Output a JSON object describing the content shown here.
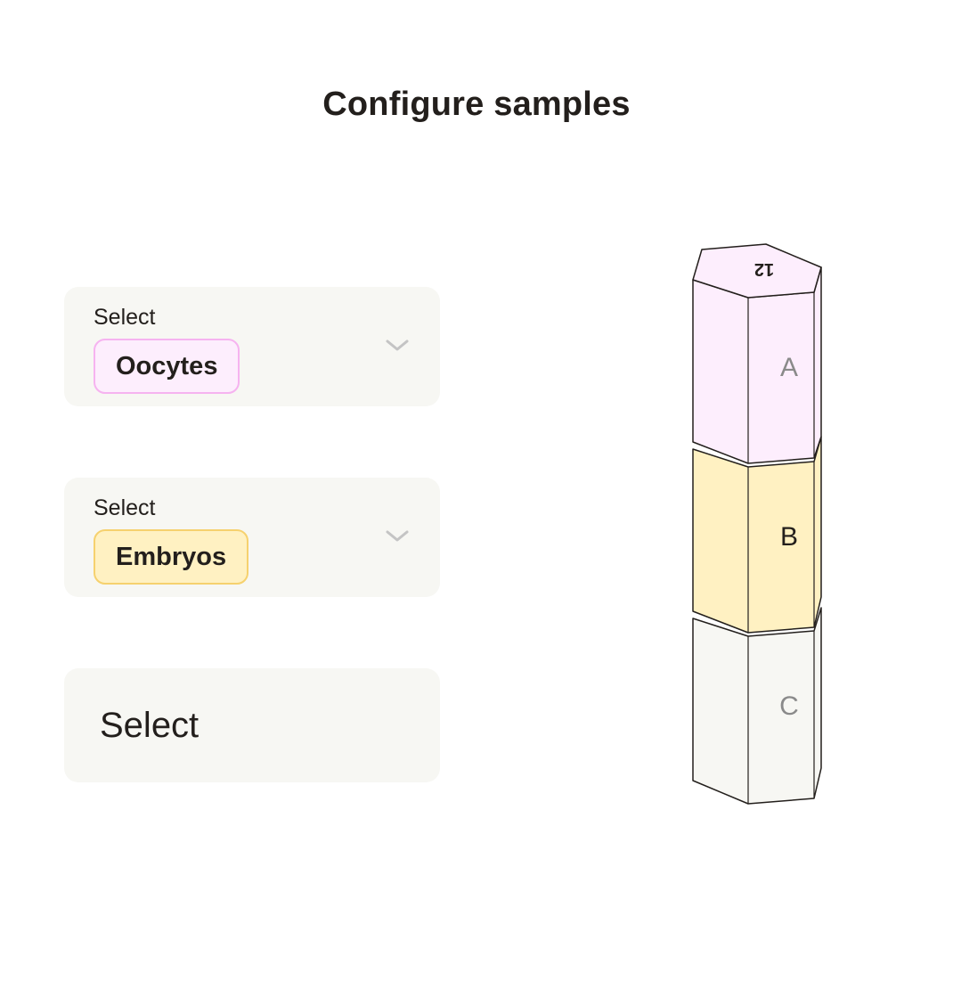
{
  "header": {
    "title": "Configure samples"
  },
  "selects": [
    {
      "label": "Select",
      "value": "Oocytes",
      "chip_bg": "#fdeefd",
      "chip_border": "#f6b3f0"
    },
    {
      "label": "Select",
      "value": "Embryos",
      "chip_bg": "#fff1c2",
      "chip_border": "#f6d16e"
    },
    {
      "placeholder": "Select"
    }
  ],
  "straw": {
    "cap_label": "12",
    "segments": [
      {
        "label": "A",
        "fill": "#fdeefd"
      },
      {
        "label": "B",
        "fill": "#fff1c2"
      },
      {
        "label": "C",
        "fill": "#f7f7f3"
      }
    ]
  },
  "colors": {
    "card_bg": "#f7f7f3",
    "text": "#231f1c",
    "chevron": "#c4c4c4"
  },
  "icons": [
    "chevron-down-icon"
  ]
}
